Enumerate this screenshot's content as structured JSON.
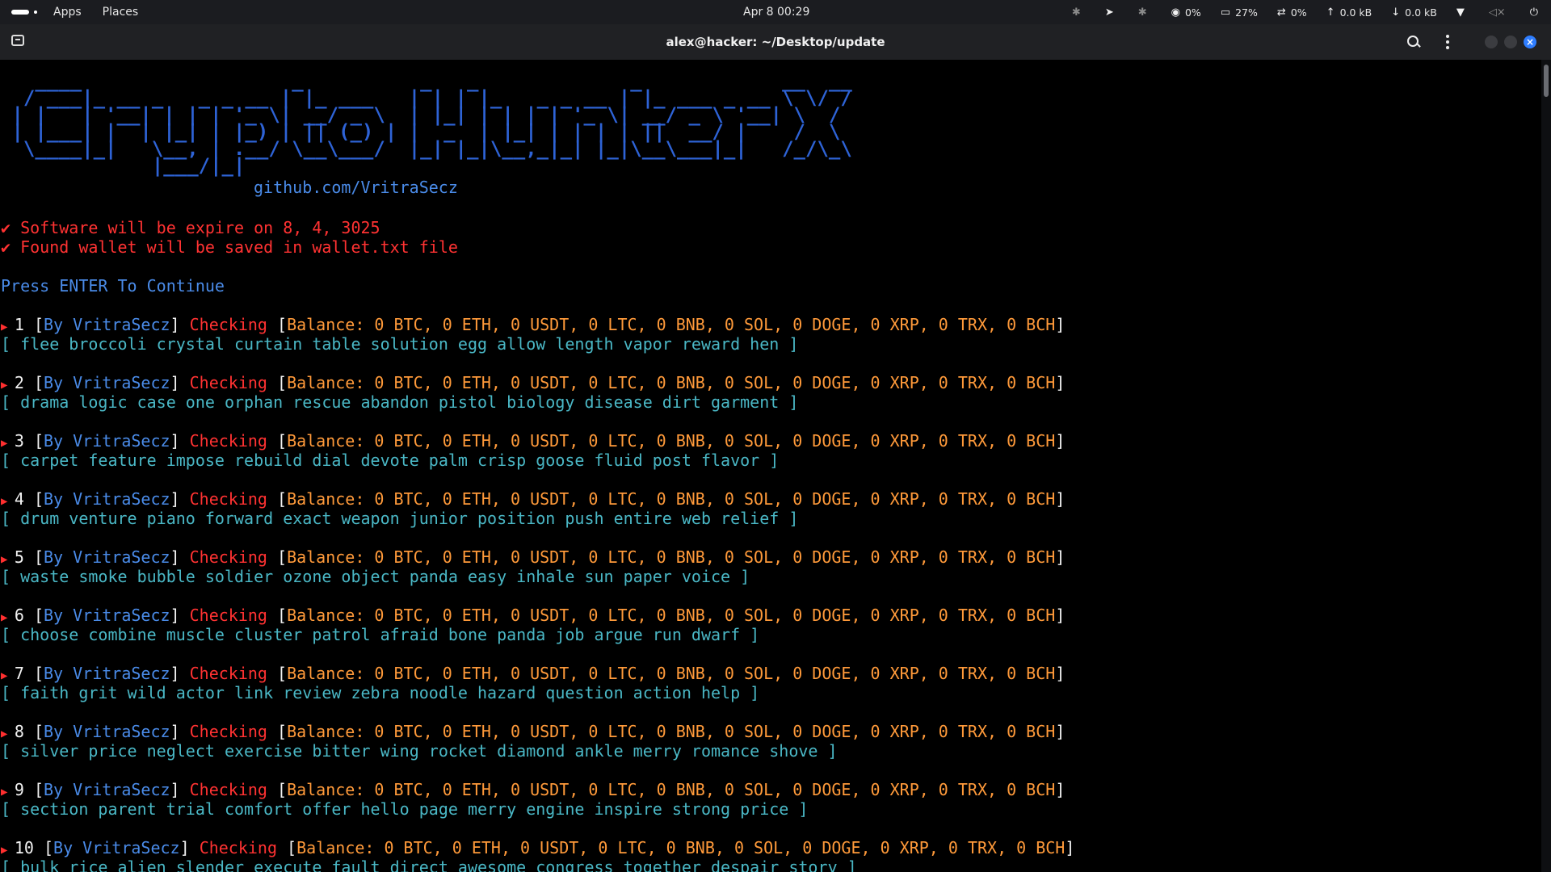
{
  "topbar": {
    "apps_label": "Apps",
    "places_label": "Places",
    "clock": "Apr 8  00:29",
    "cpu": "0%",
    "memory": "27%",
    "swap": "0%",
    "net_up": "0.0 kB",
    "net_down": "0.0 kB"
  },
  "window": {
    "title": "alex@hacker: ~/Desktop/update"
  },
  "terminal": {
    "banner_ascii": "   ____                  _          _   _             _            __  __\n  / ___|_ __ _   _ _ __ | |_ ___   | | | |_   _ _ __ | |_ ___ _ __ \\ \\/ /\n | |   | '__| | | | '_ \\| __/ _ \\  | |_| | | | | '_ \\| __/ _ \\ '__| \\  / \n | |___| |  | |_| | |_) | || (_) | |  _  | |_| | | | | ||  __/ |    /  \\ \n  \\____|_|   \\__, | .__/ \\__\\___/  |_| |_|\\__,_|_| |_|\\__\\___|_|   /_/\\_\\\n             |___/|_|",
    "github": "github.com/VritraSecz",
    "notice_1": "✔ Software will be expire on 8, 4, 3025",
    "notice_2": "✔ Found wallet will be saved in wallet.txt file",
    "prompt": "Press ENTER To Continue",
    "by_label": "By VritraSecz",
    "checking_label": "Checking",
    "balance_text": "Balance: 0 BTC, 0 ETH, 0 USDT, 0 LTC, 0 BNB, 0 SOL, 0 DOGE, 0 XRP, 0 TRX, 0 BCH",
    "entries": [
      {
        "n": "1",
        "phrase": "[ flee broccoli crystal curtain table solution egg allow length vapor reward hen ]"
      },
      {
        "n": "2",
        "phrase": "[ drama logic case one orphan rescue abandon pistol biology disease dirt garment ]"
      },
      {
        "n": "3",
        "phrase": "[ carpet feature impose rebuild dial devote palm crisp goose fluid post flavor ]"
      },
      {
        "n": "4",
        "phrase": "[ drum venture piano forward exact weapon junior position push entire web relief ]"
      },
      {
        "n": "5",
        "phrase": "[ waste smoke bubble soldier ozone object panda easy inhale sun paper voice ]"
      },
      {
        "n": "6",
        "phrase": "[ choose combine muscle cluster patrol afraid bone panda job argue run dwarf ]"
      },
      {
        "n": "7",
        "phrase": "[ faith grit wild actor link review zebra noodle hazard question action help ]"
      },
      {
        "n": "8",
        "phrase": "[ silver price neglect exercise bitter wing rocket diamond ankle merry romance shove ]"
      },
      {
        "n": "9",
        "phrase": "[ section parent trial comfort offer hello page merry engine inspire strong price ]"
      },
      {
        "n": "10",
        "phrase": "[ bulk rice alien slender execute fault direct awesome congress together despair story ]"
      }
    ]
  }
}
